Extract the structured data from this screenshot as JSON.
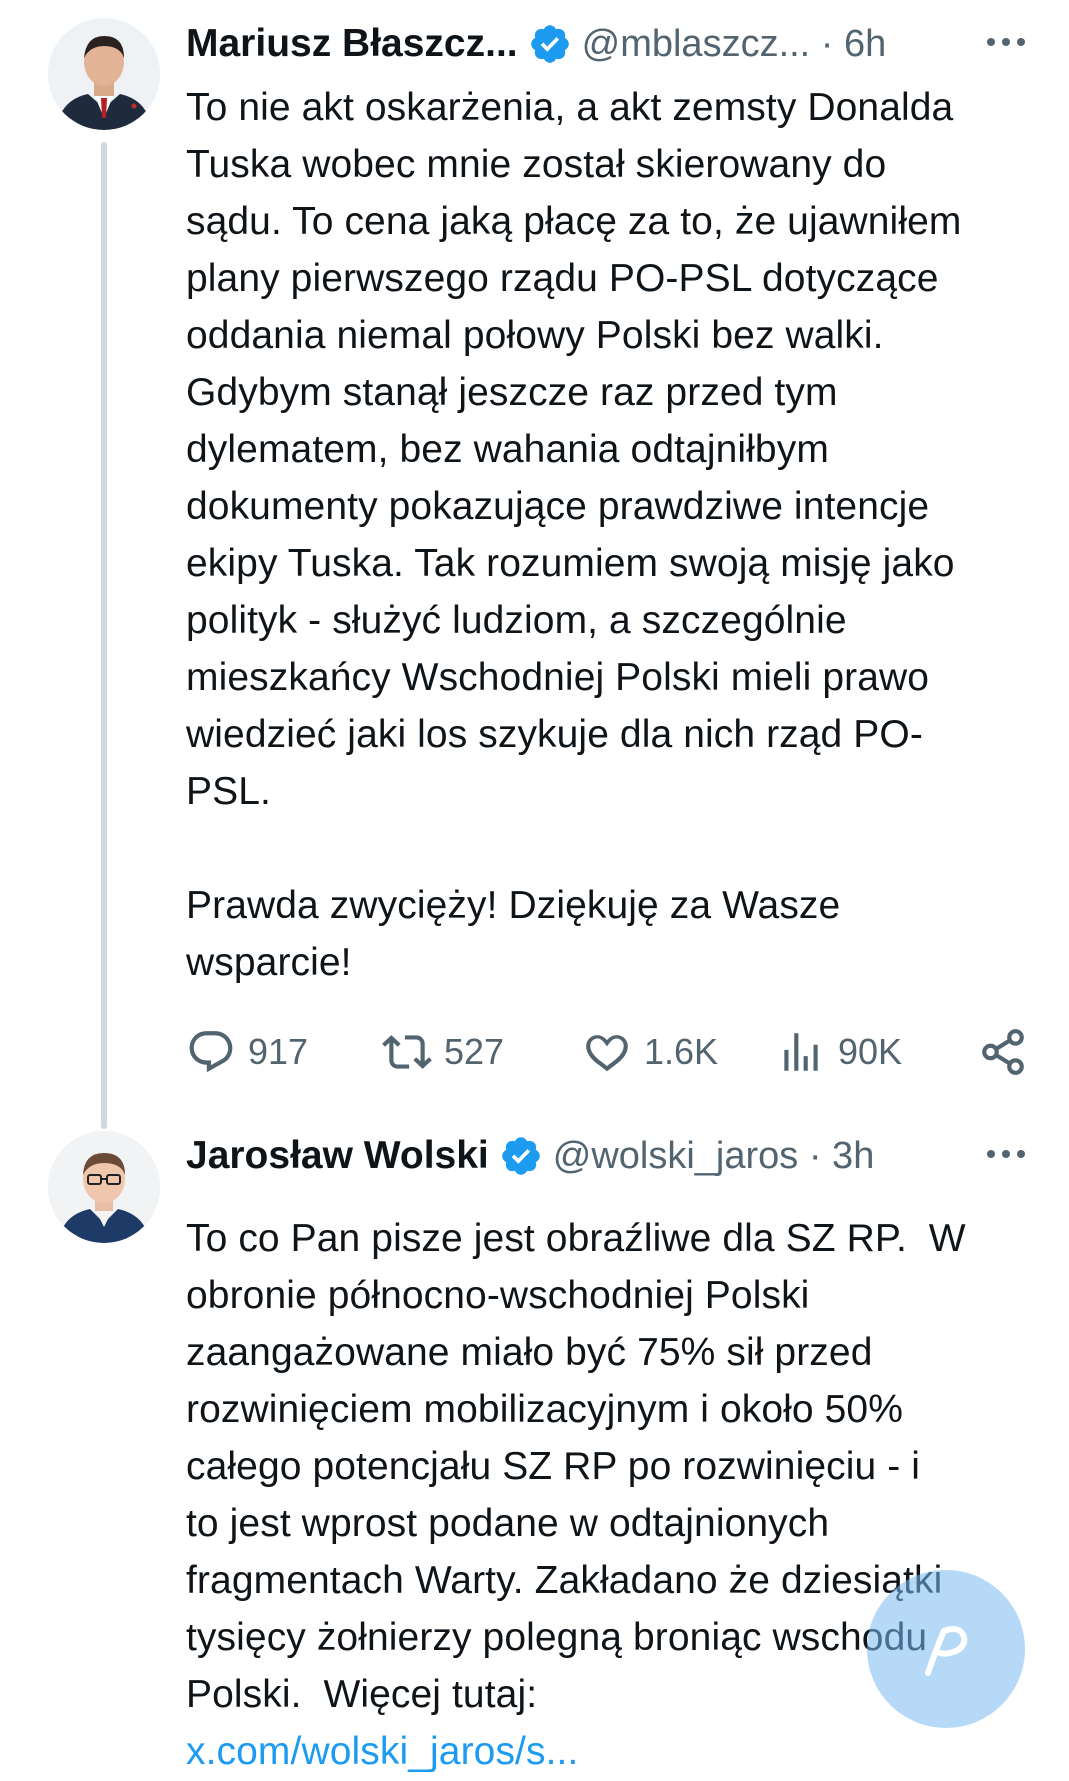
{
  "tweets": [
    {
      "author_name": "Mariusz Błaszcz...",
      "handle_time": "@mblaszcz... · 6h",
      "text": "To nie akt oskarżenia, a akt zemsty Donalda\nTuska wobec mnie został skierowany do\nsądu. To cena jaką płacę za to, że ujawniłem\nplany pierwszego rządu PO-PSL dotyczące\noddania niemal połowy Polski bez walki.\nGdybym stanął jeszcze raz przed tym\ndylematem, bez wahania odtajniłbym\ndokumenty pokazujące prawdziwe intencje\nekipy Tuska. Tak rozumiem swoją misję jako\npolityk - służyć ludziom, a szczególnie\nmieszkańcy Wschodniej Polski mieli prawo\nwiedzieć jaki los szykuje dla nich rząd PO-\nPSL.\n\nPrawda zwycięży! Dziękuję za Wasze\nwsparcie!",
      "replies": "917",
      "reposts": "527",
      "likes": "1.6K",
      "views": "90K"
    },
    {
      "author_name": "Jarosław Wolski",
      "handle_time": "@wolski_jaros · 3h",
      "text": "To co Pan pisze jest obraźliwe dla SZ RP.  W\nobronie północno-wschodniej Polski\nzaangażowane miało być 75% sił przed\nrozwinięciem mobilizacyjnym i około 50%\ncałego potencjału SZ RP po rozwinięciu - i\nto jest wprost podane w odtajnionych\nfragmentach Warty. Zakładano że dziesiątki\ntysięcy żołnierzy polegną broniąc wschodu\nPolski.  Więcej tutaj:",
      "link": "x.com/wolski_jaros/s..."
    }
  ],
  "icons": {
    "verified": "verified-badge-icon",
    "more": "more-options-icon",
    "reply": "reply-icon",
    "repost": "repost-icon",
    "like": "heart-icon",
    "views": "views-icon",
    "share": "share-icon",
    "fab": "compose-fab-icon"
  },
  "colors": {
    "text": "#0f1419",
    "secondary": "#536471",
    "accent": "#1d9bf0",
    "thread_line": "#cfd9de"
  }
}
